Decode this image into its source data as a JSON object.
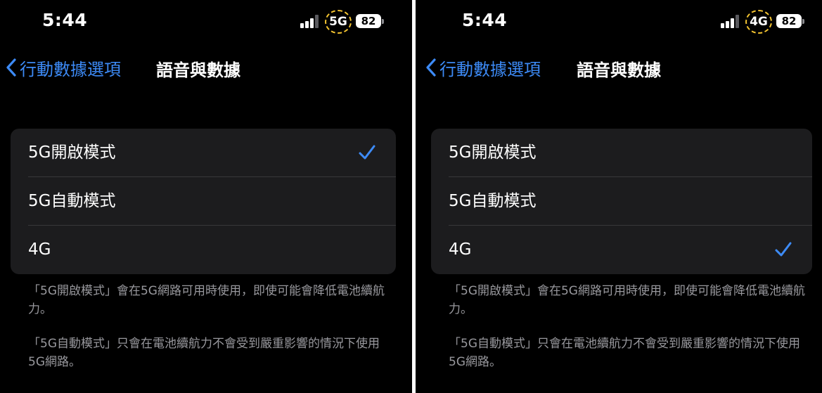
{
  "screens": [
    {
      "status": {
        "time": "5:44",
        "network": "5G",
        "battery": "82"
      },
      "nav": {
        "back_label": "行動數據選項",
        "title": "語音與數據"
      },
      "options": [
        {
          "label": "5G開啟模式",
          "selected": true
        },
        {
          "label": "5G自動模式",
          "selected": false
        },
        {
          "label": "4G",
          "selected": false
        }
      ],
      "footnotes": [
        "「5G開啟模式」會在5G網路可用時使用，即使可能會降低電池續航力。",
        "「5G自動模式」只會在電池續航力不會受到嚴重影響的情況下使用5G網路。"
      ]
    },
    {
      "status": {
        "time": "5:44",
        "network": "4G",
        "battery": "82"
      },
      "nav": {
        "back_label": "行動數據選項",
        "title": "語音與數據"
      },
      "options": [
        {
          "label": "5G開啟模式",
          "selected": false
        },
        {
          "label": "5G自動模式",
          "selected": false
        },
        {
          "label": "4G",
          "selected": true
        }
      ],
      "footnotes": [
        "「5G開啟模式」會在5G網路可用時使用，即使可能會降低電池續航力。",
        "「5G自動模式」只會在電池續航力不會受到嚴重影響的情況下使用5G網路。"
      ]
    }
  ],
  "colors": {
    "accent": "#3d8bf7",
    "highlight_ring": "#f4c430",
    "group_bg": "#1c1c1e",
    "footnote_text": "#98989d"
  },
  "icons": {
    "back": "chevron-left-icon",
    "selected": "checkmark-icon",
    "signal": "cellular-signal-icon",
    "battery": "battery-icon"
  }
}
